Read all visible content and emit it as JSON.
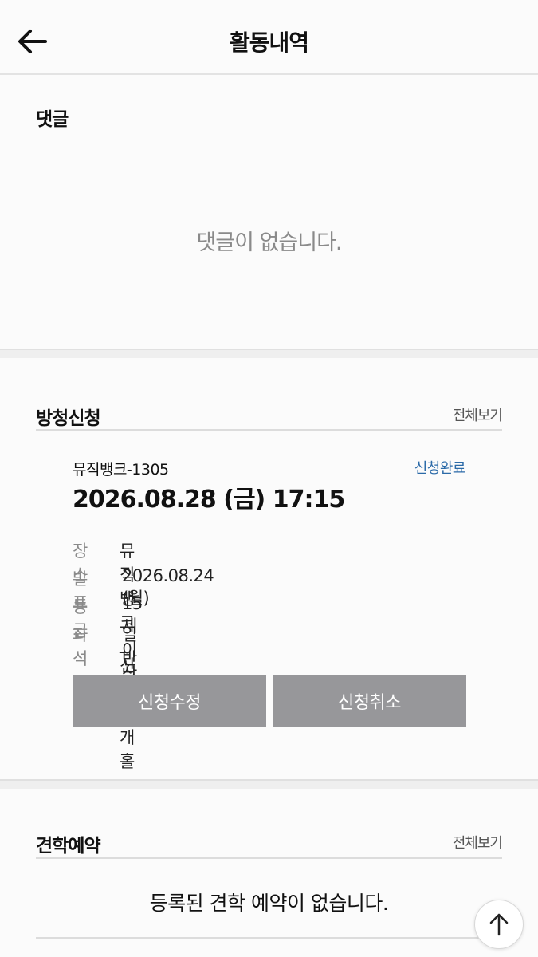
{
  "header": {
    "title": "활동내역",
    "back_icon": "arrow-left-icon"
  },
  "comments": {
    "title": "댓글",
    "empty_message": "댓글이 없습니다."
  },
  "audience": {
    "title": "방청신청",
    "view_all": "전체보기",
    "item": {
      "program": "뮤직뱅크-1305",
      "status": "신청완료",
      "datetime": "2026.08.28 (금) 17:15",
      "details": [
        {
          "label": "장소",
          "value": "뮤직뱅크_신관공개홀"
        },
        {
          "label": "발표",
          "value": "2026.08.24 (월)"
        },
        {
          "label": "등급",
          "value": "15세 이상"
        },
        {
          "label": "좌석",
          "value": "일반좌석"
        }
      ],
      "edit_button": "신청수정",
      "cancel_button": "신청취소"
    }
  },
  "tour": {
    "title": "견학예약",
    "view_all": "전체보기",
    "empty_message": "등록된 견학 예약이 없습니다."
  },
  "scroll_top_icon": "arrow-up-icon",
  "colors": {
    "accent": "#2b6aa8",
    "button_bg": "#97979a",
    "muted_text": "#8a8a8a"
  }
}
